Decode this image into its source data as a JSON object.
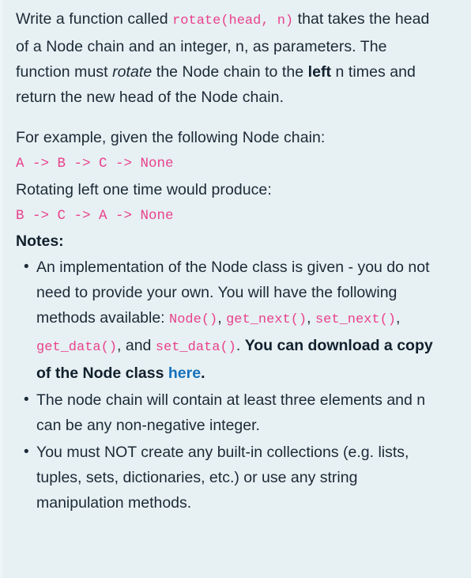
{
  "page": {
    "background_color": "#e7f0f3",
    "text_color": "#1b2a36",
    "code_color": "#e8428c",
    "link_color": "#1572bb"
  },
  "problem": {
    "intro": {
      "part1": "Write a function called ",
      "code_signature": "rotate(head, n)",
      "part2": " that takes the head of a Node chain and an integer, n, as parameters. The function must ",
      "italic_rotate": "rotate",
      "part3": " the Node chain to the ",
      "bold_left": "left",
      "part4": " n times and return the new head of the Node chain."
    },
    "example": {
      "lead_in": "For example, given the following Node chain:",
      "chain_before": "A -> B -> C -> None",
      "rotate_caption": "Rotating left one time would produce:",
      "chain_after": "B -> C -> A -> None"
    },
    "notes": {
      "heading": "Notes:",
      "items": [
        {
          "text_1": "An implementation of the Node class is given - you do not need to provide your own. You will have the following methods available: ",
          "code_1": "Node()",
          "sep_1": ", ",
          "code_2": "get_next()",
          "sep_2": ", ",
          "code_3": "set_next()",
          "sep_3": ", ",
          "code_4": "get_data()",
          "sep_4": ", and ",
          "code_5": "set_data()",
          "sep_5": ". ",
          "bold_text": "You can download a copy of the Node class ",
          "link_text": "here",
          "bold_tail": "."
        },
        {
          "text": "The node chain will contain at least three elements and n can be any non-negative integer."
        },
        {
          "text": "You must NOT create any built-in collections (e.g. lists, tuples, sets, dictionaries, etc.) or use any string manipulation methods."
        }
      ]
    }
  }
}
